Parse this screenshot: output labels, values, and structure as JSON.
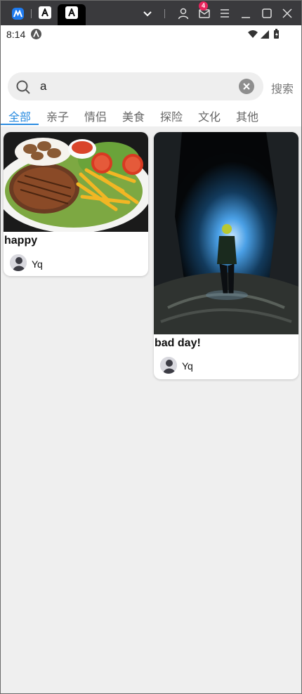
{
  "window": {
    "tab_count_badge": "4"
  },
  "status_bar": {
    "time": "8:14"
  },
  "search": {
    "query": "a",
    "submit_label": "搜索"
  },
  "tabs": [
    {
      "label": "全部",
      "active": true
    },
    {
      "label": "亲子",
      "active": false
    },
    {
      "label": "情侣",
      "active": false
    },
    {
      "label": "美食",
      "active": false
    },
    {
      "label": "探险",
      "active": false
    },
    {
      "label": "文化",
      "active": false
    },
    {
      "label": "其他",
      "active": false
    }
  ],
  "posts": [
    {
      "title": "happy",
      "author": "Yq",
      "image": "steak-and-fries-photo"
    },
    {
      "title": "bad day!",
      "author": "Yq",
      "image": "cave-hiker-photo"
    }
  ],
  "colors": {
    "accent": "#2a8ce0",
    "feed_bg": "#efefef",
    "chrome_bg": "#3a3a3d"
  }
}
